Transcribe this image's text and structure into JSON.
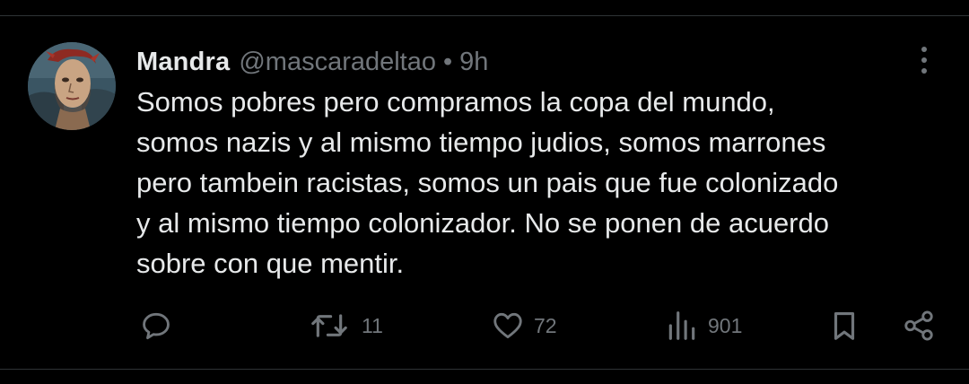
{
  "tweet": {
    "author": {
      "display_name": "Mandra",
      "handle": "@mascaradeltao"
    },
    "separator": "•",
    "time": "9h",
    "text_lines": [
      "Somos pobres pero compramos la copa del mundo,",
      "somos nazis y al mismo tiempo judios, somos marrones",
      "pero tambein racistas, somos un pais que fue colonizado",
      "y al mismo tiempo colonizador. No se ponen de acuerdo",
      "sobre con que mentir."
    ],
    "stats": {
      "retweets": "11",
      "likes": "72",
      "views": "901"
    }
  },
  "icons": {
    "reply": "speech-bubble-icon",
    "retweet": "retweet-arrows-icon",
    "like": "heart-icon",
    "views": "bar-chart-icon",
    "bookmark": "bookmark-icon",
    "share": "share-nodes-icon",
    "more": "vertical-dots-icon"
  },
  "colors": {
    "background": "#000000",
    "text_primary": "#e7e9ea",
    "text_secondary": "#71767b",
    "divider": "#2f3336"
  }
}
